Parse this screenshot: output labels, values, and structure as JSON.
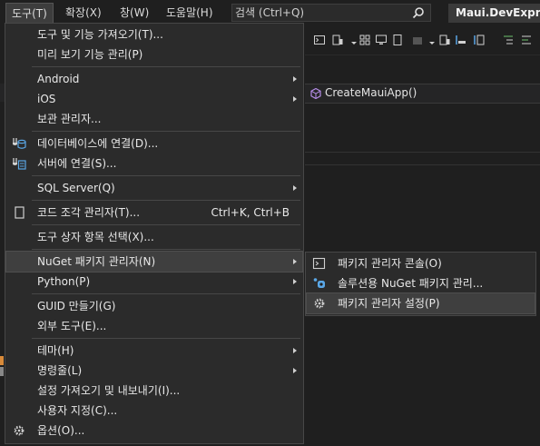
{
  "menubar": {
    "items": [
      {
        "label": "도구(T)",
        "active": true
      },
      {
        "label": "확장(X)"
      },
      {
        "label": "창(W)"
      },
      {
        "label": "도움말(H)"
      }
    ],
    "search": {
      "placeholder": "검색 (Ctrl+Q)"
    },
    "solution_name": "Maui.DevExpres"
  },
  "editor": {
    "nav_member": "CreateMauiApp()"
  },
  "tools_menu": {
    "items": [
      {
        "label": "도구 및 기능 가져오기(T)..."
      },
      {
        "label": "미리 보기 기능 관리(P)"
      },
      {
        "label": "Android",
        "submenu": true
      },
      {
        "label": "iOS",
        "submenu": true
      },
      {
        "label": "보관 관리자..."
      },
      {
        "label": "데이터베이스에 연결(D)...",
        "icon": "database-connect-icon"
      },
      {
        "label": "서버에 연결(S)...",
        "icon": "server-connect-icon"
      },
      {
        "label": "SQL Server(Q)",
        "submenu": true
      },
      {
        "label": "코드 조각 관리자(T)...",
        "shortcut": "Ctrl+K, Ctrl+B",
        "icon": "code-snippet-icon"
      },
      {
        "label": "도구 상자 항목 선택(X)..."
      },
      {
        "label": "NuGet 패키지 관리자(N)",
        "submenu": true,
        "highlighted": true
      },
      {
        "label": "Python(P)",
        "submenu": true
      },
      {
        "label": "GUID 만들기(G)"
      },
      {
        "label": "외부 도구(E)..."
      },
      {
        "label": "테마(H)",
        "submenu": true
      },
      {
        "label": "명령줄(L)",
        "submenu": true
      },
      {
        "label": "설정 가져오기 및 내보내기(I)..."
      },
      {
        "label": "사용자 지정(C)..."
      },
      {
        "label": "옵션(O)...",
        "icon": "gear-icon"
      }
    ]
  },
  "nuget_submenu": {
    "items": [
      {
        "label": "패키지 관리자 콘솔(O)",
        "icon": "console-icon"
      },
      {
        "label": "솔루션용 NuGet 패키지 관리...",
        "icon": "nuget-icon"
      },
      {
        "label": "패키지 관리자 설정(P)",
        "icon": "gear-icon",
        "highlighted": true
      }
    ]
  },
  "colors": {
    "menu_bg": "#2b2b2b",
    "highlight_bg": "#3f3f3f",
    "accent": "#8cc8ff"
  }
}
